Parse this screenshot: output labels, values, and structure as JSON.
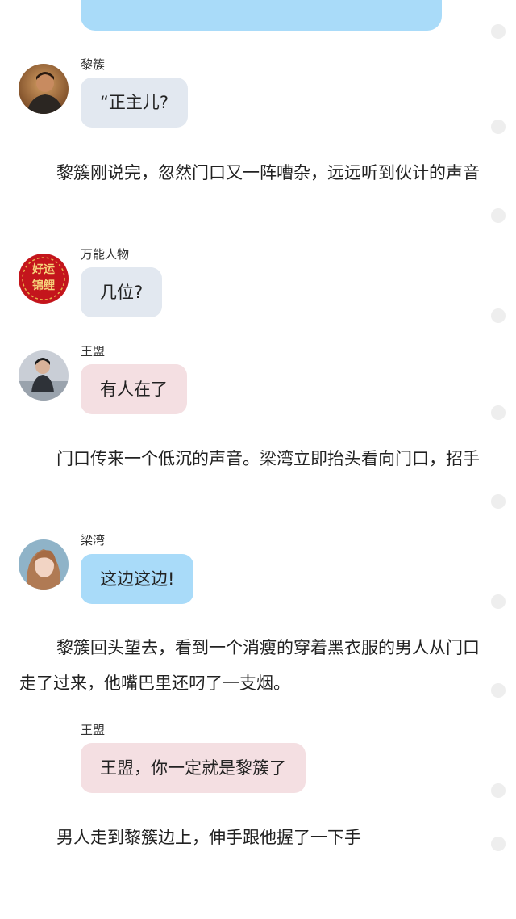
{
  "messages": [
    {
      "speaker": "黎簇",
      "text": "“正主儿?"
    },
    {
      "speaker": "万能人物",
      "text": "几位?"
    },
    {
      "speaker": "王盟",
      "text": "有人在了"
    },
    {
      "speaker": "梁湾",
      "text": "这边这边!"
    },
    {
      "speaker": "王盟",
      "text": "王盟，你一定就是黎簇了"
    }
  ],
  "narration": [
    "黎簇刚说完，忽然门口又一阵嘈杂，远远听到伙计的声音",
    "门口传来一个低沉的声音。梁湾立即抬头看向门口，招手",
    "黎簇回头望去，看到一个消瘦的穿着黑衣服的男人从门口走了过来，他嘴巴里还叼了一支烟。",
    "男人走到黎簇边上，伸手跟他握了一下手"
  ],
  "avatar_texts": {
    "wanneng": [
      "好运",
      "锦鲤"
    ]
  },
  "colors": {
    "bubble_gray": "#e2e8f0",
    "bubble_pink": "#f4dfe2",
    "bubble_blue": "#a9dbf9",
    "dot": "#eeeeee"
  }
}
